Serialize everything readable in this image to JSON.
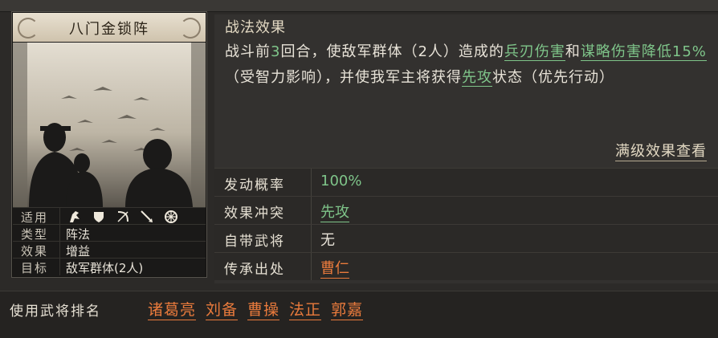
{
  "card": {
    "title": "八门金锁阵",
    "attributes": {
      "applicable_label": "适用",
      "applicable_icons": [
        "cavalry-icon",
        "shield-icon",
        "bow-icon",
        "spear-icon",
        "wheel-icon"
      ],
      "type_label": "类型",
      "type_value": "阵法",
      "effect_label": "效果",
      "effect_value": "增益",
      "target_label": "目标",
      "target_value": "敌军群体(2人)"
    }
  },
  "tactic": {
    "section_title": "战法效果",
    "desc_parts": {
      "p1": "战斗前",
      "p2": "3",
      "p3": "回合，使敌军群体（2人）造成的",
      "p4": "兵刃伤害",
      "p5": "和",
      "p6": "谋略伤害降低15%",
      "p7": "（受智力影响），并使我军主将获得",
      "p8": "先攻",
      "p9": "状态（优先行动）"
    },
    "max_level_link": "满级效果查看"
  },
  "properties": [
    {
      "label": "发动概率",
      "value": "100%"
    },
    {
      "label": "效果冲突",
      "value": "先攻"
    },
    {
      "label": "自带武将",
      "value": "无"
    },
    {
      "label": "传承出处",
      "value": "曹仁"
    }
  ],
  "usage": {
    "label": "使用武将排名",
    "generals": [
      "诸葛亮",
      "刘备",
      "曹操",
      "法正",
      "郭嘉"
    ]
  },
  "colors": {
    "highlight_green": "#7fc58a",
    "link_orange": "#e87a3c",
    "title_band": "#e8e0d0"
  }
}
